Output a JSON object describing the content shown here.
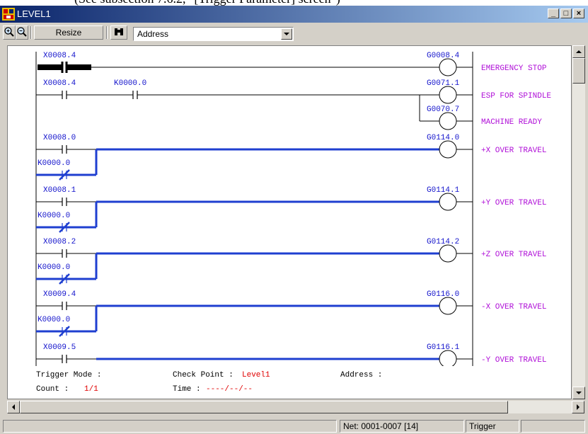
{
  "caption": "(See subsection 7.6.2, \"[Trigger Parameter] screen\")",
  "window": {
    "title": "LEVEL1",
    "minimize": "_",
    "maximize": "□",
    "close": "×"
  },
  "toolbar": {
    "zoom_in_icon": "zoom-in-icon",
    "zoom_out_icon": "zoom-out-icon",
    "resize_label": "Resize",
    "search_icon": "binoculars-icon",
    "address_select": "Address"
  },
  "ladder": {
    "rungs": [
      {
        "contacts": [
          "X0008.4"
        ],
        "branch": null,
        "coils": [
          {
            "addr": "G0008.4",
            "comment": "EMERGENCY STOP"
          }
        ]
      },
      {
        "contacts": [
          "X0008.4",
          "K0000.0"
        ],
        "branch": null,
        "coils": [
          {
            "addr": "G0071.1",
            "comment": "ESP FOR SPINDLE"
          },
          {
            "addr": "G0070.7",
            "comment": "MACHINE READY"
          }
        ]
      },
      {
        "contacts": [
          "X0008.0"
        ],
        "branch": "K0000.0",
        "coils": [
          {
            "addr": "G0114.0",
            "comment": "+X OVER TRAVEL"
          }
        ]
      },
      {
        "contacts": [
          "X0008.1"
        ],
        "branch": "K0000.0",
        "coils": [
          {
            "addr": "G0114.1",
            "comment": "+Y OVER TRAVEL"
          }
        ]
      },
      {
        "contacts": [
          "X0008.2"
        ],
        "branch": "K0000.0",
        "coils": [
          {
            "addr": "G0114.2",
            "comment": "+Z OVER TRAVEL"
          }
        ]
      },
      {
        "contacts": [
          "X0009.4"
        ],
        "branch": "K0000.0",
        "coils": [
          {
            "addr": "G0116.0",
            "comment": "-X OVER TRAVEL"
          }
        ]
      },
      {
        "contacts": [
          "X0009.5"
        ],
        "branch": null,
        "coils": [
          {
            "addr": "G0116.1",
            "comment": "-Y OVER TRAVEL"
          }
        ]
      }
    ],
    "colors": {
      "address": "#1414cc",
      "comment": "#b010d8",
      "active": "#1f3fd0",
      "line": "#000000"
    }
  },
  "trigger": {
    "mode_label": "Trigger Mode :",
    "count_label": "Count :",
    "count_value": "1/1",
    "checkpoint_label": "Check Point :",
    "checkpoint_value": "Level1",
    "time_label": "Time :",
    "time_value": "----/--/--",
    "address_label": "Address :"
  },
  "statusbar": {
    "net": "Net: 0001-0007 [14]",
    "mode": "Trigger"
  }
}
